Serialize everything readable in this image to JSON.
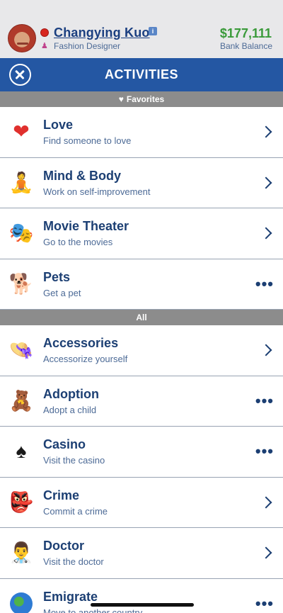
{
  "header": {
    "name": "Changying Kuo",
    "job": "Fashion Designer",
    "balance": "$177,111",
    "balance_label": "Bank Balance"
  },
  "titlebar": {
    "title": "ACTIVITIES"
  },
  "sections": {
    "favorites": "Favorites",
    "all": "All"
  },
  "favorites": [
    {
      "label": "Love",
      "sub": "Find someone to love",
      "icon": "heart-icon",
      "action": "chevron"
    },
    {
      "label": "Mind & Body",
      "sub": "Work on self-improvement",
      "icon": "meditation-icon",
      "action": "chevron"
    },
    {
      "label": "Movie Theater",
      "sub": "Go to the movies",
      "icon": "theater-masks-icon",
      "action": "chevron"
    },
    {
      "label": "Pets",
      "sub": "Get a pet",
      "icon": "dog-icon",
      "action": "more"
    }
  ],
  "all": [
    {
      "label": "Accessories",
      "sub": "Accessorize yourself",
      "icon": "hat-icon",
      "action": "chevron"
    },
    {
      "label": "Adoption",
      "sub": "Adopt a child",
      "icon": "teddy-bear-icon",
      "action": "more"
    },
    {
      "label": "Casino",
      "sub": "Visit the casino",
      "icon": "spade-icon",
      "action": "more"
    },
    {
      "label": "Crime",
      "sub": "Commit a crime",
      "icon": "demon-mask-icon",
      "action": "chevron"
    },
    {
      "label": "Doctor",
      "sub": "Visit the doctor",
      "icon": "doctor-icon",
      "action": "chevron"
    },
    {
      "label": "Emigrate",
      "sub": "Move to another country",
      "icon": "globe-icon",
      "action": "more"
    }
  ],
  "colors": {
    "header_bg": "#e8e8ea",
    "titlebar_bg": "#2457a3",
    "section_bg": "#8c8c8c",
    "text_primary": "#1c3f73",
    "money": "#3a9a3a"
  }
}
